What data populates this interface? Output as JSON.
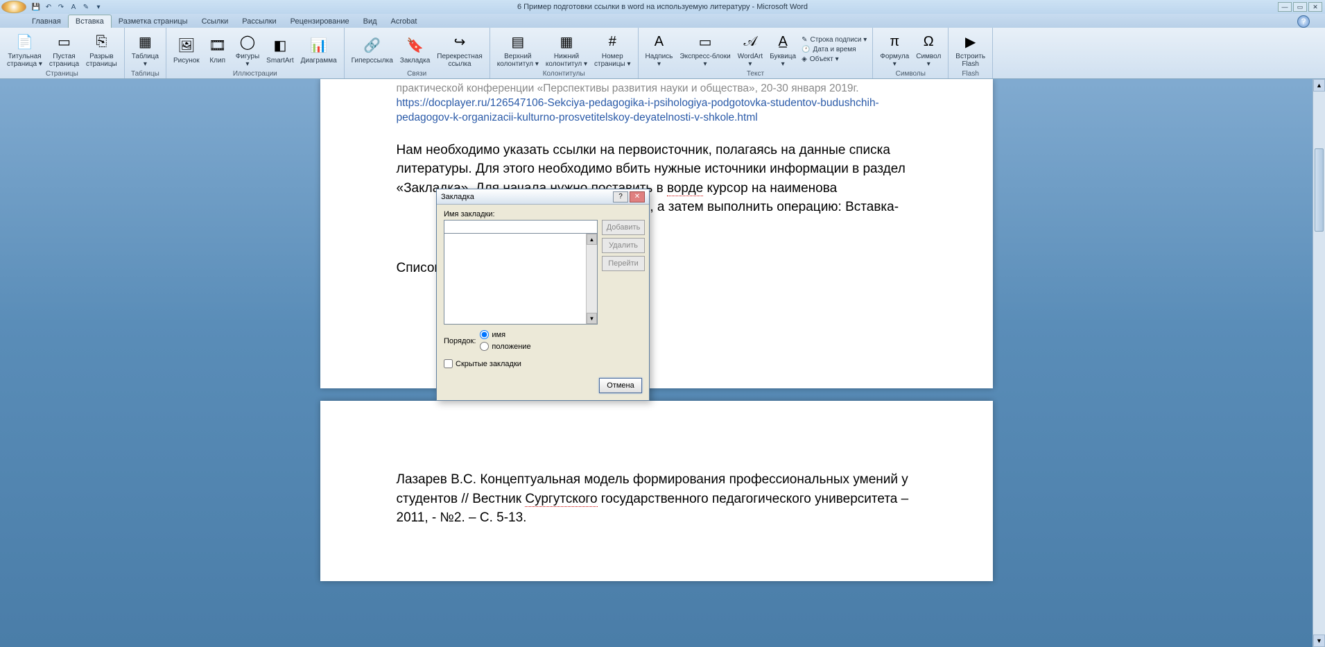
{
  "app": {
    "title": "6 Пример подготовки ссылки в word на используемую литературу - Microsoft Word"
  },
  "qat": {
    "save": "💾",
    "undo": "↶",
    "redo": "↷",
    "brush": "A",
    "eraser": "✎"
  },
  "tabs": [
    "Главная",
    "Вставка",
    "Разметка страницы",
    "Ссылки",
    "Рассылки",
    "Рецензирование",
    "Вид",
    "Acrobat"
  ],
  "active_tab": 1,
  "ribbon": {
    "groups": [
      {
        "label": "Страницы",
        "items": [
          {
            "icon": "📄",
            "lbl": "Титульная\nстраница ▾",
            "name": "cover-page"
          },
          {
            "icon": "▭",
            "lbl": "Пустая\nстраница",
            "name": "blank-page"
          },
          {
            "icon": "⎘",
            "lbl": "Разрыв\nстраницы",
            "name": "page-break"
          }
        ]
      },
      {
        "label": "Таблицы",
        "items": [
          {
            "icon": "▦",
            "lbl": "Таблица\n▾",
            "name": "table"
          }
        ]
      },
      {
        "label": "Иллюстрации",
        "items": [
          {
            "icon": "🖼",
            "lbl": "Рисунок",
            "name": "picture"
          },
          {
            "icon": "🎞",
            "lbl": "Клип",
            "name": "clip"
          },
          {
            "icon": "◯",
            "lbl": "Фигуры\n▾",
            "name": "shapes"
          },
          {
            "icon": "◧",
            "lbl": "SmartArt",
            "name": "smartart"
          },
          {
            "icon": "📊",
            "lbl": "Диаграмма",
            "name": "chart"
          }
        ]
      },
      {
        "label": "Связи",
        "items": [
          {
            "icon": "🔗",
            "lbl": "Гиперссылка",
            "name": "hyperlink"
          },
          {
            "icon": "🔖",
            "lbl": "Закладка",
            "name": "bookmark"
          },
          {
            "icon": "↪",
            "lbl": "Перекрестная\nссылка",
            "name": "crossref"
          }
        ]
      },
      {
        "label": "Колонтитулы",
        "items": [
          {
            "icon": "▤",
            "lbl": "Верхний\nколонтитул ▾",
            "name": "header"
          },
          {
            "icon": "▦",
            "lbl": "Нижний\nколонтитул ▾",
            "name": "footer"
          },
          {
            "icon": "#",
            "lbl": "Номер\nстраницы ▾",
            "name": "page-number"
          }
        ]
      },
      {
        "label": "Текст",
        "items": [
          {
            "icon": "A",
            "lbl": "Надпись\n▾",
            "name": "textbox"
          },
          {
            "icon": "▭",
            "lbl": "Экспресс-блоки\n▾",
            "name": "quickparts"
          },
          {
            "icon": "𝒜",
            "lbl": "WordArt\n▾",
            "name": "wordart"
          },
          {
            "icon": "A̲",
            "lbl": "Буквица\n▾",
            "name": "dropcap"
          }
        ],
        "side": [
          {
            "icon": "✎",
            "lbl": "Строка подписи ▾",
            "name": "signature-line"
          },
          {
            "icon": "🕐",
            "lbl": "Дата и время",
            "name": "date-time"
          },
          {
            "icon": "◈",
            "lbl": "Объект ▾",
            "name": "object"
          }
        ]
      },
      {
        "label": "Символы",
        "items": [
          {
            "icon": "π",
            "lbl": "Формула\n▾",
            "name": "equation"
          },
          {
            "icon": "Ω",
            "lbl": "Символ\n▾",
            "name": "symbol"
          }
        ]
      },
      {
        "label": "Flash",
        "items": [
          {
            "icon": "▶",
            "lbl": "Встроить\nFlash",
            "name": "embed-flash"
          }
        ]
      }
    ]
  },
  "document": {
    "grey1": "практической конференции «Перспективы развития науки и общества», 20-30 января 2019г.",
    "grey2": "https://docplayer.ru/126547106-Sekciya-pedagogika-i-psihologiya-podgotovka-studentov-budushchih-pedagogov-k-organizacii-kulturno-prosvetitelskoy-deyatelnosti-v-shkole.html",
    "para1": "Нам необходимо указать ссылки на первоисточник, полагаясь на данные списка литературы. Для этого необходимо вбить нужные источники информации в раздел «Закладка». Для начала нужно поставить в ",
    "para1_word": "ворде",
    "para1_cont": " курсор на наименова",
    "para1_tail": "ры), а затем выполнить операцию: Вставка-",
    "heading": "Список литературы",
    "ref": "Лазарев В.С. Концептуальная модель формирования профессиональных умений у студентов // Вестник ",
    "ref_u": "Сургутского",
    "ref_cont": " государственного педагогического университета – 2011, - №2. – С. 5-13."
  },
  "dialog": {
    "title": "Закладка",
    "label_name": "Имя закладки:",
    "btn_add": "Добавить",
    "btn_del": "Удалить",
    "btn_go": "Перейти",
    "sort_label": "Порядок:",
    "sort_name": "имя",
    "sort_pos": "положение",
    "hidden": "Скрытые закладки",
    "cancel": "Отмена"
  },
  "win": {
    "min": "—",
    "max": "▭",
    "close": "✕",
    "help": "?"
  }
}
